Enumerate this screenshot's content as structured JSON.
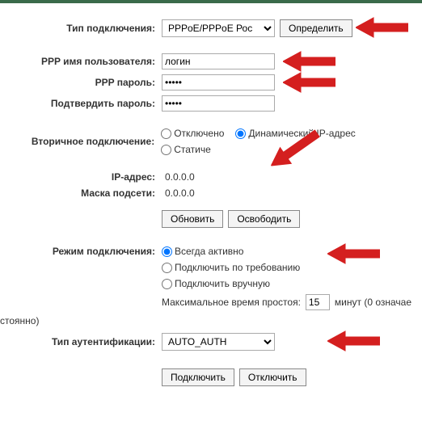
{
  "connection_type": {
    "label": "Тип подключения:",
    "value": "PPPoE/PPPoE Рос",
    "detect_button": "Определить"
  },
  "ppp": {
    "username_label": "PPP имя пользователя:",
    "username_value": "логин",
    "password_label": "PPP пароль:",
    "password_value": "•••••",
    "confirm_label": "Подтвердить пароль:",
    "confirm_value": "•••••"
  },
  "secondary": {
    "label": "Вторичное подключение:",
    "opt_disabled": "Отключено",
    "opt_dynamic": "Динамический IP-адрес",
    "opt_static": "Статиче"
  },
  "ip": {
    "ip_label": "IP-адрес:",
    "ip_value": "0.0.0.0",
    "mask_label": "Маска подсети:",
    "mask_value": "0.0.0.0",
    "refresh_button": "Обновить",
    "release_button": "Освободить"
  },
  "mode": {
    "label": "Режим подключения:",
    "opt_always": "Всегда активно",
    "opt_demand": "Подключить по требованию",
    "opt_manual": "Подключить вручную",
    "idle_label_prefix": "Максимальное время простоя:",
    "idle_value": "15",
    "idle_label_suffix": "минут (0 означае",
    "truncated_note": "стоянно)"
  },
  "auth": {
    "label": "Тип аутентификации:",
    "value": "AUTO_AUTH"
  },
  "actions": {
    "connect": "Подключить",
    "disconnect": "Отключить"
  }
}
